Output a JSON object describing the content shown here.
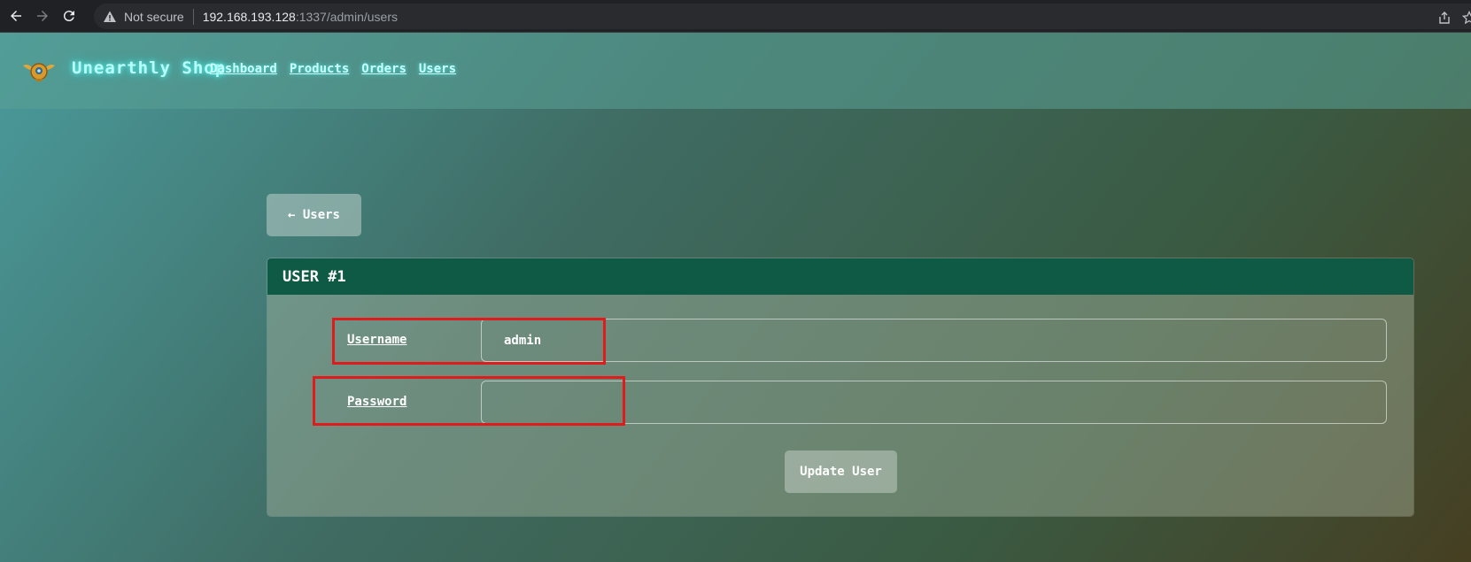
{
  "browser": {
    "security_label": "Not secure",
    "url_host": "192.168.193.128",
    "url_rest": ":1337/admin/users"
  },
  "site": {
    "brand": "Unearthly Shop",
    "nav": [
      {
        "label": "Dashboard"
      },
      {
        "label": "Products"
      },
      {
        "label": "Orders"
      },
      {
        "label": "Users"
      }
    ]
  },
  "main": {
    "back_label": "← Users",
    "card_title": "USER #1",
    "fields": {
      "username": {
        "label": "Username",
        "value": "admin"
      },
      "password": {
        "label": "Password",
        "value": ""
      }
    },
    "submit_label": "Update User"
  },
  "colors": {
    "accent_glow": "#5ff4ee",
    "card_header": "#0e5a45",
    "highlight": "#e01b1b"
  },
  "icons": [
    "back-arrow-icon",
    "forward-arrow-icon",
    "reload-icon",
    "warning-icon",
    "share-icon",
    "bookmark-star-icon",
    "shop-logo-icon"
  ]
}
